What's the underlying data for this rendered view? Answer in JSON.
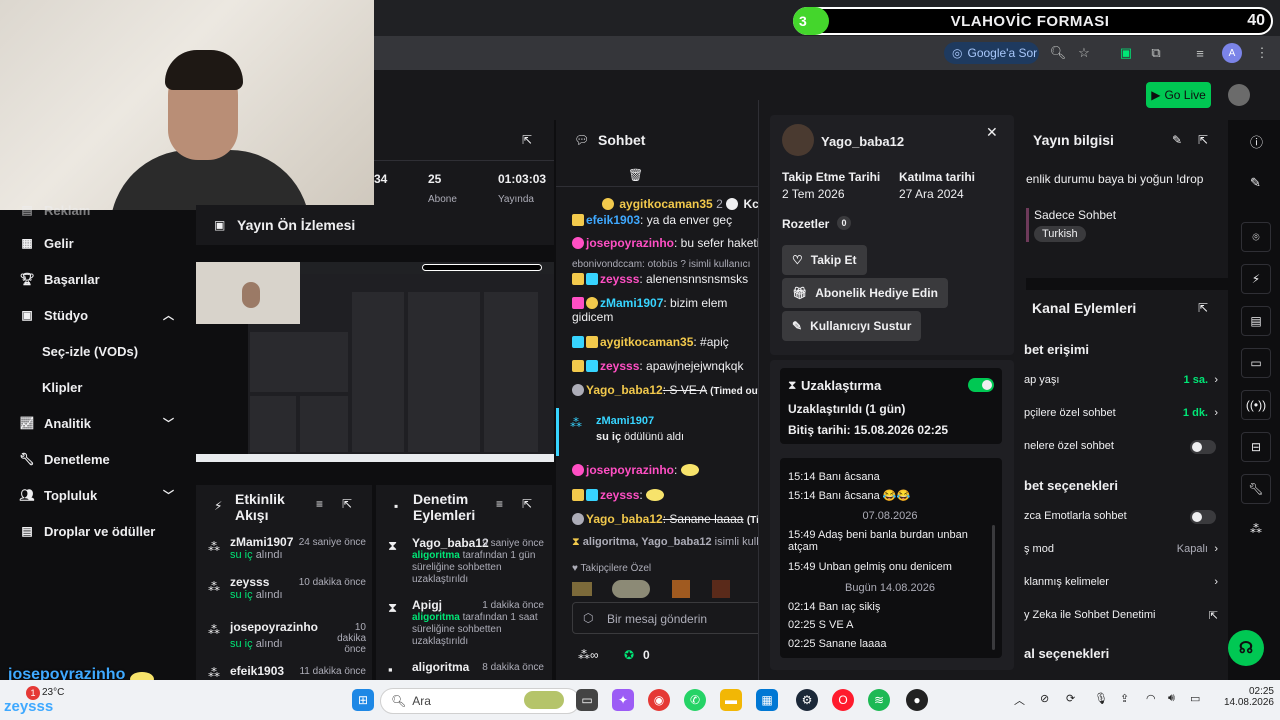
{
  "banner": {
    "badge": "3",
    "title": "VLAHOVİC FORMASI",
    "count": "40"
  },
  "browser": {
    "search_label": "Google'a Sor"
  },
  "header": {
    "go_live": "Go Live"
  },
  "stats": {
    "s1": "34",
    "s2": "25",
    "s3": "01:03:03",
    "s2_sub": "Abone",
    "s3_sub": "Yayında"
  },
  "left_nav": {
    "items": [
      {
        "label": "Reklam",
        "icon": "ad-icon"
      },
      {
        "label": "Gelir",
        "icon": "revenue-icon"
      },
      {
        "label": "Başarılar",
        "icon": "trophy-icon"
      },
      {
        "label": "Stüdyo",
        "icon": "studio-icon"
      },
      {
        "label": "Seç-izle (VODs)",
        "icon": ""
      },
      {
        "label": "Klipler",
        "icon": ""
      },
      {
        "label": "Analitik",
        "icon": "analytics-icon"
      },
      {
        "label": "Denetleme",
        "icon": "wrench-icon"
      },
      {
        "label": "Topluluk",
        "icon": "community-icon"
      },
      {
        "label": "Droplar ve ödüller",
        "icon": "drops-icon"
      }
    ]
  },
  "preview": {
    "title": "Yayın Ön İzlemesi"
  },
  "activity": {
    "title": "Etkinlik Akışı",
    "items": [
      {
        "name": "zMami1907",
        "time": "24 saniye önce",
        "desc": "su iç",
        "suffix": "alındı"
      },
      {
        "name": "zeysss",
        "time": "10 dakika önce",
        "desc": "su iç",
        "suffix": "alındı"
      },
      {
        "name": "josepoyrazinho",
        "time": "10 dakika önce",
        "desc": "su iç",
        "suffix": "alındı"
      },
      {
        "name": "efeik1903",
        "time": "11 dakika önce",
        "desc": "",
        "suffix": ""
      }
    ]
  },
  "mod_actions": {
    "title": "Denetim Eylemleri",
    "items": [
      {
        "name": "Yago_baba12",
        "time": "9 saniye önce",
        "actor": "aligoritma",
        "desc": "tarafından 1 gün süreliğine sohbetten uzaklaştırıldı"
      },
      {
        "name": "Apigj",
        "time": "1 dakika önce",
        "actor": "aligoritma",
        "desc": "tarafından 1 saat süreliğine sohbetten uzaklaştırıldı"
      },
      {
        "name": "aligoritma",
        "time": "8 dakika önce",
        "actor": "",
        "desc": ""
      }
    ]
  },
  "chat": {
    "title": "Sohbet",
    "pinned": [
      {
        "user": "aygitkocaman35",
        "count": "2"
      },
      {
        "user": "Kc",
        "count": ""
      }
    ],
    "lines": [
      {
        "user": "efeik1903",
        "msg": ": ya da enver geç"
      },
      {
        "user": "josepoyrazinho",
        "msg": ": bu sefer haketi"
      },
      {
        "user": "",
        "msg": "ebonivondccam: otobüs ? isimli kullanıcı"
      },
      {
        "user": "zeysss",
        "msg": ": alenensnnsnsmsks"
      },
      {
        "user": "zMami1907",
        "msg": ": bizim elem gidicem"
      },
      {
        "user": "aygitkocaman35",
        "msg": ": #apiç"
      },
      {
        "user": "zeysss",
        "msg": ": apawjnejejwnqkqk"
      },
      {
        "user": "Yago_baba12",
        "msg": ": S VE A",
        "note": "(Timed out)"
      },
      {
        "user": "zMami1907",
        "msg": "su iç",
        "suffix": "ödülünü aldı"
      },
      {
        "user": "josepoyrazinho",
        "msg": ":"
      },
      {
        "user": "zeysss",
        "msg": ":"
      },
      {
        "user": "Yago_baba12",
        "msg": ": Sanane laaaa",
        "note": "(Timed"
      },
      {
        "user": "aligoritma, Yago_baba12",
        "msg": "isimli kullan"
      }
    ],
    "followers_label": "Takipçilere Özel",
    "input_placeholder": "Bir mesaj gönderin",
    "points": "0"
  },
  "user_card": {
    "username": "Yago_baba12",
    "follow_label": "Takip Etme Tarihi",
    "follow_date": "2 Tem 2026",
    "join_label": "Katılma tarihi",
    "join_date": "27 Ara 2024",
    "badges_label": "Rozetler",
    "badges_count": "0",
    "btn_follow": "Takip Et",
    "btn_gift": "Abonelik Hediye Edin",
    "btn_mute": "Kullanıcıyı Sustur",
    "timeout_label": "Uzaklaştırma",
    "timeout_status": "Uzaklaştırıldı (1 gün)",
    "timeout_end": "Bitiş tarihi: 15.08.2026 02:25",
    "history": [
      {
        "type": "msg",
        "text": "15:14 Banı âcsana"
      },
      {
        "type": "msg",
        "text": "15:14 Banı âcsana 😂😂"
      },
      {
        "type": "date",
        "text": "07.08.2026"
      },
      {
        "type": "msg",
        "text": "15:49 Adaş beni banla burdan unban atçam"
      },
      {
        "type": "msg",
        "text": "15:49 Unban gelmiş onu denicem"
      },
      {
        "type": "date",
        "text": "Bugün 14.08.2026"
      },
      {
        "type": "msg",
        "text": "02:14 Ban ıaç sikiş"
      },
      {
        "type": "msg",
        "text": "02:25 S VE A"
      },
      {
        "type": "msg",
        "text": "02:25 Sanane laaaa"
      }
    ]
  },
  "stream_info": {
    "title": "Yayın bilgisi",
    "text": "enlik durumu baya bi yoğun !drop",
    "category": "Sadece Sohbet",
    "tag": "Turkish"
  },
  "channel_actions": {
    "title": "Kanal Eylemleri",
    "sec1": "bet erişimi",
    "rows1": [
      {
        "label": "ap yaşı",
        "val": "1 sa."
      },
      {
        "label": "pçilere özel sohbet",
        "val": "1 dk."
      },
      {
        "label": "nelere özel sohbet",
        "val": ""
      }
    ],
    "sec2": "bet seçenekleri",
    "rows2": [
      {
        "label": "zca Emotlarla sohbet",
        "val": ""
      },
      {
        "label": "ş mod",
        "val": "Kapalı"
      },
      {
        "label": "klanmış kelimeler",
        "val": ""
      },
      {
        "label": "y Zeka ile Sohbet Denetimi",
        "val": ""
      }
    ],
    "sec3": "al seçenekleri"
  },
  "overlay": {
    "name1": "josepoyrazinho",
    "name2": "zeysss"
  },
  "taskbar": {
    "weather": "23°C",
    "search": "Ara",
    "time": "02:25",
    "date": "14.08.2026"
  },
  "colors": {
    "accent": "#00c853",
    "bg": "#18181b",
    "brand_purple": "#9147ff"
  }
}
